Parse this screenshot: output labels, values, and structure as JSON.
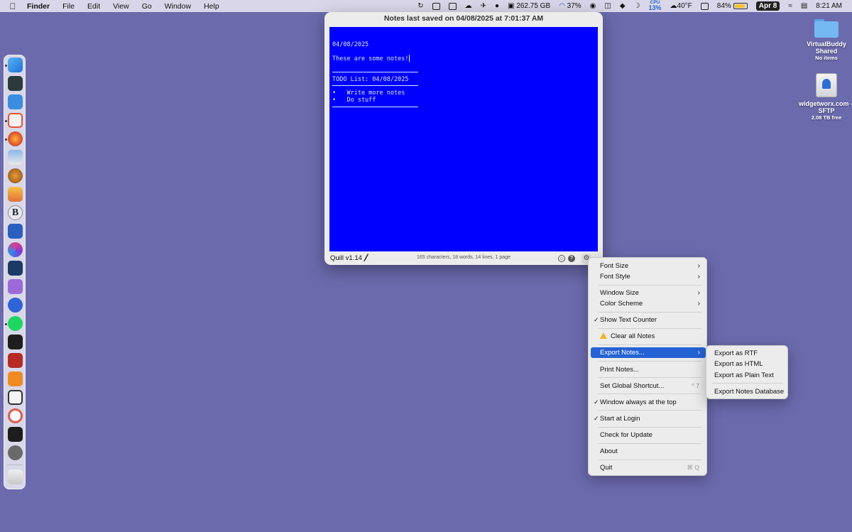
{
  "menubar": {
    "apple_icon": "apple-icon",
    "app": "Finder",
    "menus": [
      "File",
      "Edit",
      "View",
      "Go",
      "Window",
      "Help"
    ],
    "disk": "262.75 GB",
    "progress": "37%",
    "cpu_label": "CPU",
    "cpu_value": "13%",
    "weather": "40°F",
    "battery": "84%",
    "date": "Apr 8",
    "time": "8:21 AM"
  },
  "desktop": {
    "items": [
      {
        "name": "VirtualBuddy Shared",
        "sub": "No items"
      },
      {
        "name": "widgetworx.com – SFTP",
        "sub": "2.08 TB free"
      }
    ]
  },
  "window": {
    "title": "Notes last saved on 04/08/2025 at 7:01:37 AM",
    "editor_lines": {
      "date": "04/08/2025",
      "note": "These are some notes!",
      "todo_title": "TODO List: 04/08/2025",
      "todo_1": "•   Write more notes",
      "todo_2": "•   Do stuff"
    },
    "editor_bg": "#0000ff",
    "app_name": "Quill v1.14",
    "counter": "165 characters, 18 words, 14 lines, 1 page"
  },
  "context_menu": {
    "font_size": "Font Size",
    "font_style": "Font Style",
    "window_size": "Window Size",
    "color_scheme": "Color Scheme",
    "show_counter": "Show Text Counter",
    "clear_notes": "Clear all Notes",
    "export_notes": "Export Notes...",
    "print_notes": "Print Notes...",
    "global_shortcut": "Set Global Shortcut...",
    "global_shortcut_key": "^ 7",
    "always_top": "Window always at the top",
    "start_login": "Start at Login",
    "check_update": "Check for Update",
    "about": "About",
    "quit": "Quit",
    "quit_key": "⌘ Q",
    "highlight_color": "#2563d4"
  },
  "export_submenu": {
    "rtf": "Export as RTF",
    "html": "Export as HTML",
    "plain": "Export as Plain Text",
    "database": "Export Notes Database"
  }
}
